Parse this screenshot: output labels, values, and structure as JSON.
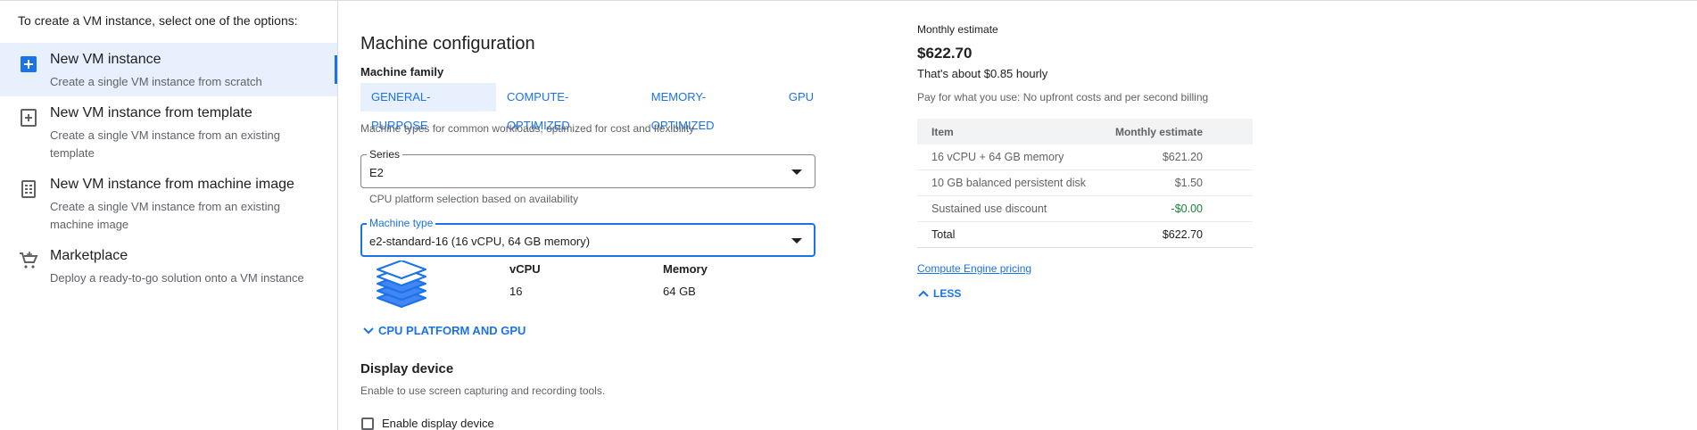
{
  "sidebar": {
    "intro": "To create a VM instance, select one of the options:",
    "options": [
      {
        "title": "New VM instance",
        "desc": "Create a single VM instance from scratch",
        "icon": "add-box-icon"
      },
      {
        "title": "New VM instance from template",
        "desc": "Create a single VM instance from an existing template",
        "icon": "template-add-icon"
      },
      {
        "title": "New VM instance from machine image",
        "desc": "Create a single VM instance from an existing machine image",
        "icon": "machine-image-icon"
      },
      {
        "title": "Marketplace",
        "desc": "Deploy a ready-to-go solution onto a VM instance",
        "icon": "cart-icon"
      }
    ]
  },
  "machine_config": {
    "heading": "Machine configuration",
    "family_label": "Machine family",
    "tabs": [
      "GENERAL-PURPOSE",
      "COMPUTE-OPTIMIZED",
      "MEMORY-OPTIMIZED",
      "GPU"
    ],
    "active_tab": "GENERAL-PURPOSE",
    "family_desc": "Machine types for common workloads, optimized for cost and flexibility",
    "series": {
      "label": "Series",
      "value": "E2",
      "helper": "CPU platform selection based on availability"
    },
    "machine_type": {
      "label": "Machine type",
      "value": "e2-standard-16 (16 vCPU, 64 GB memory)"
    },
    "specs": {
      "vcpu_label": "vCPU",
      "vcpu_value": "16",
      "memory_label": "Memory",
      "memory_value": "64 GB"
    },
    "cpu_platform_button": "CPU PLATFORM AND GPU"
  },
  "display_device": {
    "heading": "Display device",
    "desc": "Enable to use screen capturing and recording tools.",
    "checkbox_label": "Enable display device",
    "checked": false
  },
  "estimate": {
    "title": "Monthly estimate",
    "price": "$622.70",
    "hourly": "That's about $0.85 hourly",
    "note": "Pay for what you use: No upfront costs and per second billing",
    "table_headers": [
      "Item",
      "Monthly estimate"
    ],
    "rows": [
      {
        "item": "16 vCPU + 64 GB memory",
        "cost": "$621.20"
      },
      {
        "item": "10 GB balanced persistent disk",
        "cost": "$1.50"
      },
      {
        "item": "Sustained use discount",
        "cost": "-$0.00"
      }
    ],
    "total_label": "Total",
    "total_value": "$622.70",
    "pricing_link": "Compute Engine pricing",
    "less_button": "LESS"
  },
  "colors": {
    "accent": "#1a73e8",
    "selected_bg": "#e8f0fe",
    "discount": "#188038"
  }
}
